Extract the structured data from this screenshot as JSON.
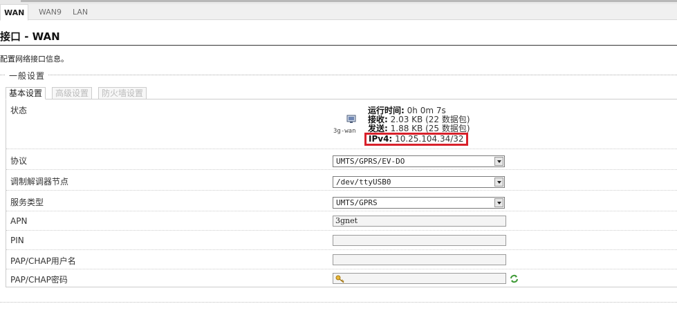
{
  "tabs": [
    {
      "label": "WAN",
      "active": true
    },
    {
      "label": "WAN9",
      "active": false
    },
    {
      "label": "LAN",
      "active": false
    }
  ],
  "page": {
    "title": "接口 - WAN",
    "description": "配置网络接口信息。"
  },
  "section": {
    "legend": "一般设置",
    "subtabs": [
      "基本设置",
      "高级设置",
      "防火墙设置"
    ]
  },
  "status": {
    "label": "状态",
    "ifname": "3g-wan",
    "uptime_label": "运行时间:",
    "uptime_value": "0h 0m 7s",
    "rx_label": "接收:",
    "rx_value": "2.03 KB (22 数据包)",
    "tx_label": "发送:",
    "tx_value": "1.88 KB (25 数据包)",
    "ipv4_label": "IPv4:",
    "ipv4_value": "10.25.104.34/32",
    "highlight_color": "#d8202a"
  },
  "fields": {
    "protocol": {
      "label": "协议",
      "value": "UMTS/GPRS/EV-DO"
    },
    "modem": {
      "label": "调制解调器节点",
      "value": "/dev/ttyUSB0"
    },
    "service": {
      "label": "服务类型",
      "value": "UMTS/GPRS"
    },
    "apn": {
      "label": "APN",
      "value": "3gnet"
    },
    "pin": {
      "label": "PIN",
      "value": ""
    },
    "username": {
      "label": "PAP/CHAP用户名",
      "value": ""
    },
    "password": {
      "label": "PAP/CHAP密码",
      "value": ""
    }
  },
  "icons": {
    "interface": "network-interface-icon",
    "key": "key-icon",
    "reveal": "reveal-password-icon"
  }
}
